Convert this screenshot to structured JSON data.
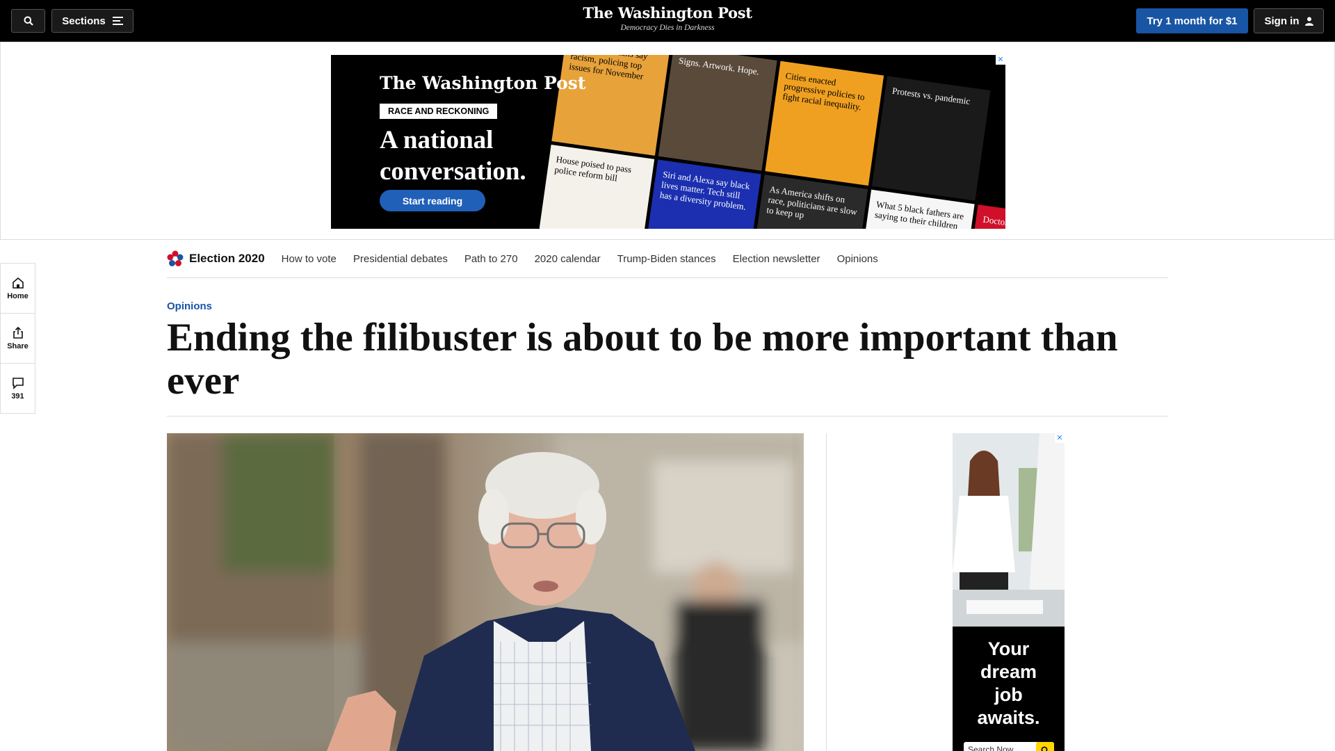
{
  "topbar": {
    "sections_label": "Sections",
    "logo": "The Washington Post",
    "tagline": "Democracy Dies in Darkness",
    "try_label": "Try 1 month for $1",
    "signin_label": "Sign in"
  },
  "banner_ad": {
    "logo": "The Washington Post",
    "pill": "RACE AND RECKONING",
    "headline_line1": "A national",
    "headline_line2": "conversation.",
    "cta": "Start reading",
    "close": "✕",
    "tiles": [
      {
        "text": "Black Americans say racism, policing top issues for November",
        "bg": "#e8a23a",
        "fg": "#000"
      },
      {
        "text": "Signs. Artwork. Hope.",
        "bg": "#5a4a3a",
        "fg": "#fff"
      },
      {
        "text": "Cities enacted progressive policies to fight racial inequality.",
        "bg": "#f0a020",
        "fg": "#000"
      },
      {
        "text": "Protests vs. pandemic",
        "bg": "#1a1a1a",
        "fg": "#fff"
      },
      {
        "text": "House poised to pass police reform bill",
        "bg": "#f4f1ea",
        "fg": "#000"
      },
      {
        "text": "Siri and Alexa say black lives matter. Tech still has a diversity problem.",
        "bg": "#1b2fb0",
        "fg": "#fff"
      },
      {
        "text": "As America shifts on race, politicians are slow to keep up",
        "bg": "#2a2a2a",
        "fg": "#fff"
      },
      {
        "text": "What 5 black fathers are saying to their children",
        "bg": "#f6f6f6",
        "fg": "#000"
      },
      {
        "text": "Doctors: racism in h",
        "bg": "#d0102a",
        "fg": "#fff"
      }
    ]
  },
  "rail": {
    "home": "Home",
    "share": "Share",
    "comments": "391"
  },
  "election_nav": {
    "brand": "Election 2020",
    "links": [
      "How to vote",
      "Presidential debates",
      "Path to 270",
      "2020 calendar",
      "Trump-Biden stances",
      "Election newsletter",
      "Opinions"
    ]
  },
  "article": {
    "kicker": "Opinions",
    "headline": "Ending the filibuster is about to be more important than ever"
  },
  "side_ad": {
    "text_line1": "Your",
    "text_line2": "dream",
    "text_line3": "job",
    "text_line4": "awaits.",
    "search_placeholder": "Search Now",
    "close": "✕"
  },
  "colors": {
    "accent_blue": "#1955a5",
    "topbar_bg": "#000000",
    "rule": "#dddddd"
  },
  "icons": [
    "search-icon",
    "menu-icon",
    "user-icon",
    "home-icon",
    "share-icon",
    "comment-icon",
    "election-star-icon",
    "close-icon"
  ]
}
